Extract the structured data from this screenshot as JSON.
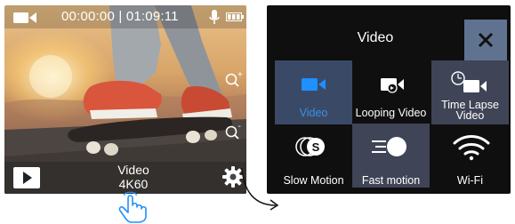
{
  "camera": {
    "timer": "00:00:00 | 01:09:11",
    "mode_line1": "Video",
    "mode_line2": "4K60",
    "zoom_in_symbol": "+",
    "zoom_out_symbol": "-",
    "icons": {
      "top_left": "video-camera-icon",
      "mic": "microphone-icon",
      "battery": "battery-icon",
      "zoom_in": "zoom-in-icon",
      "zoom_out": "zoom-out-icon",
      "playback": "play-icon",
      "settings": "gear-icon",
      "hand": "tap-hand-icon",
      "arrow": "curved-arrow-icon"
    }
  },
  "menu": {
    "title": "Video",
    "close_icon": "close-icon",
    "items": [
      {
        "label": "Video",
        "icon": "video-camera-icon",
        "selected": true
      },
      {
        "label": "Looping Video",
        "icon": "loop-video-icon",
        "selected": false
      },
      {
        "label_line1": "Time Lapse",
        "label_line2": "Video",
        "icon": "timelapse-video-icon",
        "selected": false
      },
      {
        "label": "Slow Motion",
        "icon": "slow-motion-icon",
        "selected": false
      },
      {
        "label": "Fast motion",
        "icon": "fast-motion-icon",
        "selected": false
      },
      {
        "label": "Wi-Fi",
        "icon": "wifi-icon",
        "selected": false
      }
    ]
  },
  "colors": {
    "panel_bg": "#0f0f0f",
    "selected_tile": "#3a4a66",
    "close_button": "#5f7391",
    "accent_blue": "#1e90ff"
  }
}
